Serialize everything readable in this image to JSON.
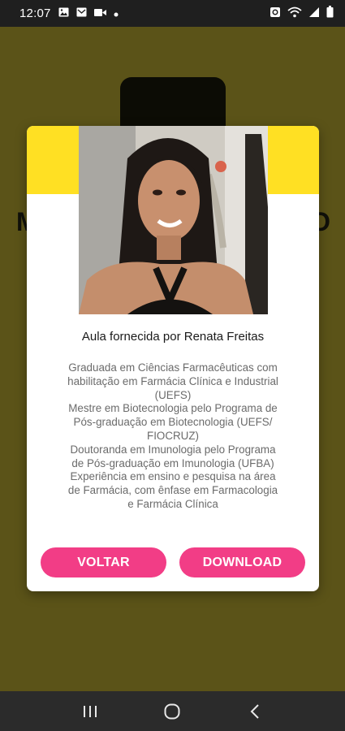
{
  "status_bar": {
    "time": "12:07",
    "left_icons": [
      "gallery-icon",
      "mail-icon",
      "video-icon",
      "dot-icon"
    ],
    "right_icons": [
      "alarm-icon",
      "wifi-icon",
      "signal-icon",
      "battery-icon"
    ]
  },
  "background": {
    "title_left": "M",
    "title_right": "O"
  },
  "dialog": {
    "header_color": "#ffe023",
    "title": "Aula fornecida por Renata Freitas",
    "bio_lines": [
      "Graduada em Ciências Farmacêuticas com",
      "habilitação em Farmácia Clínica e Industrial",
      "(UEFS)",
      "Mestre em Biotecnologia pelo Programa de",
      "Pós-graduação em Biotecnologia (UEFS/",
      "FIOCRUZ)",
      "Doutoranda em Imunologia pelo Programa",
      "de Pós-graduação em Imunologia (UFBA)",
      "Experiência em ensino e pesquisa na área",
      "de Farmácia, com ênfase em Farmacologia",
      "e Farmácia Clínica"
    ],
    "back_label": "VOLTAR",
    "download_label": "DOWNLOAD",
    "button_color": "#f23d86"
  },
  "nav_bar": {
    "icons": [
      "recents-icon",
      "home-icon",
      "back-icon"
    ]
  }
}
